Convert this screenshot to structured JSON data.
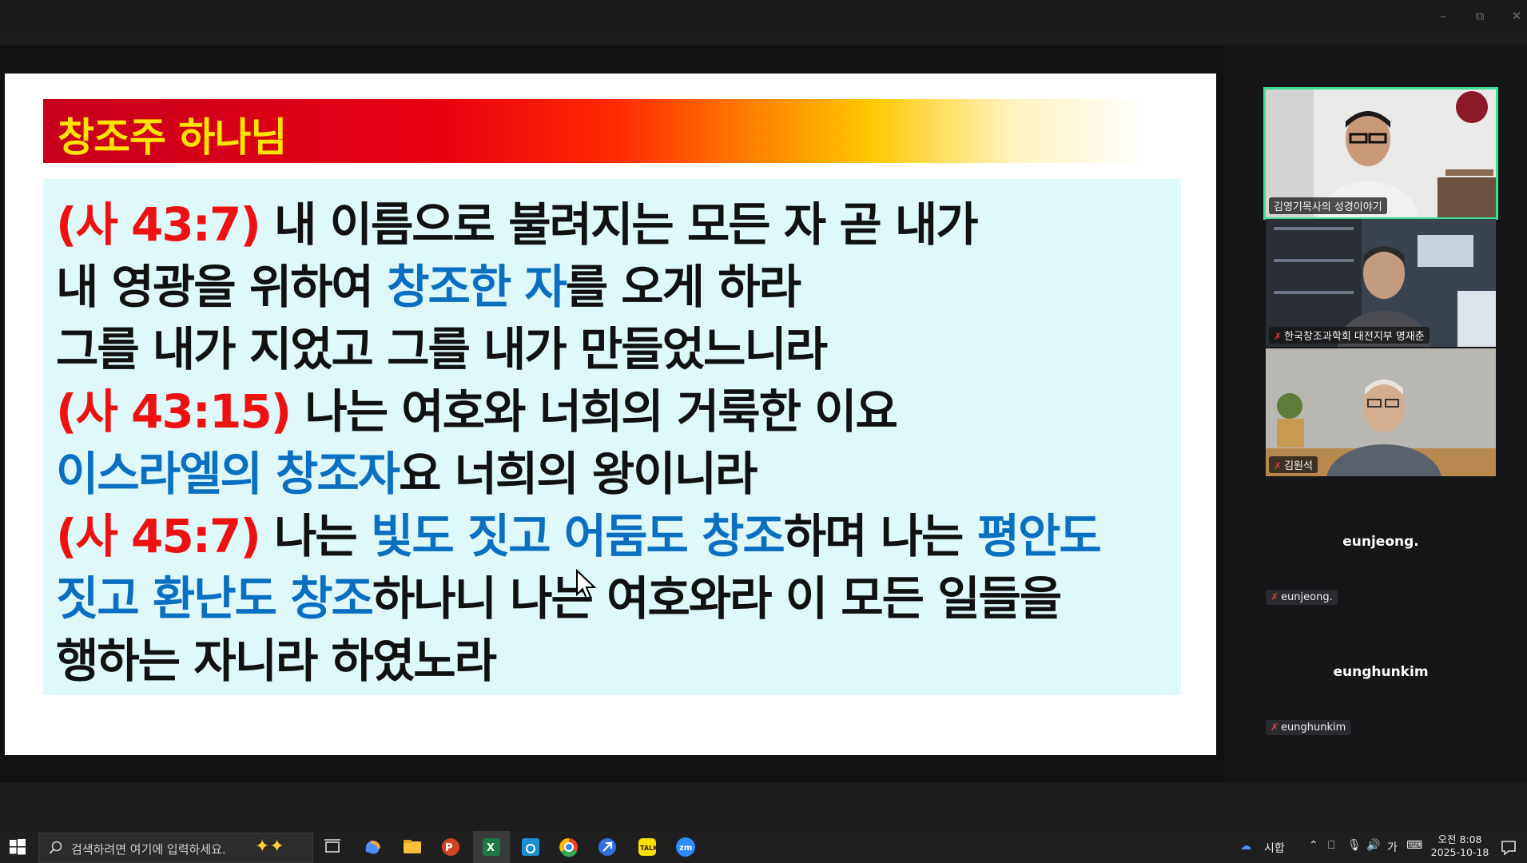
{
  "slide": {
    "title": "창조주 하나님",
    "lines": [
      [
        {
          "t": "(사 43:7)",
          "c": "ref"
        },
        {
          "t": " 내 이름으로 불려지는 모든 자 곧 내가",
          "c": ""
        }
      ],
      [
        {
          "t": "내 영광을 위하여 ",
          "c": ""
        },
        {
          "t": "창조한 자",
          "c": "blue"
        },
        {
          "t": "를 오게 하라",
          "c": ""
        }
      ],
      [
        {
          "t": "그를 내가 지었고 그를 내가 만들었느니라",
          "c": ""
        }
      ],
      [
        {
          "t": "(사 43:15)",
          "c": "ref"
        },
        {
          "t": " 나는 여호와 너희의 거룩한 이요",
          "c": ""
        }
      ],
      [
        {
          "t": "이스라엘의 창조자",
          "c": "blue"
        },
        {
          "t": "요 너희의 왕이니라",
          "c": ""
        }
      ],
      [
        {
          "t": "(사 45:7)",
          "c": "ref"
        },
        {
          "t": " 나는 ",
          "c": ""
        },
        {
          "t": "빛도 짓고 어둠도 창조",
          "c": "blue"
        },
        {
          "t": "하며 나는 ",
          "c": ""
        },
        {
          "t": "평안도",
          "c": "blue"
        }
      ],
      [
        {
          "t": "짓고 환난도 창조",
          "c": "blue"
        },
        {
          "t": "하나니 나는 여호와라 이 모든 일들을",
          "c": ""
        }
      ],
      [
        {
          "t": "행하는 자니라 하였노라",
          "c": ""
        }
      ]
    ]
  },
  "participants": {
    "p1": "김영기목사의 성경이야기",
    "p2": "한국창조과학회 대전지부 명재춘",
    "p3": "김원석",
    "p4_name": "eunjeong.",
    "p4_label": "eunjeong.",
    "p5_name": "eunghunkim",
    "p5_label": "eunghunkim"
  },
  "taskbar": {
    "search_placeholder": "검색하려면 여기에 입력하세요.",
    "weather": "시합",
    "ime": "가",
    "time": "오전 8:08",
    "date": "2025-10-18"
  },
  "colors": {
    "ref": "#ee1111",
    "blue": "#0a6fc1",
    "title": "#ffe400",
    "box": "#dff9fb",
    "active_speaker": "#3fdc93"
  },
  "icons": [
    "windows-start-icon",
    "search-icon",
    "task-view-icon",
    "copilot-icon",
    "file-explorer-icon",
    "powerpoint-icon",
    "excel-icon",
    "hangul-icon",
    "chrome-icon",
    "arrow-app-icon",
    "kakaotalk-icon",
    "zoom-icon",
    "mic-muted-icon",
    "notification-icon"
  ]
}
